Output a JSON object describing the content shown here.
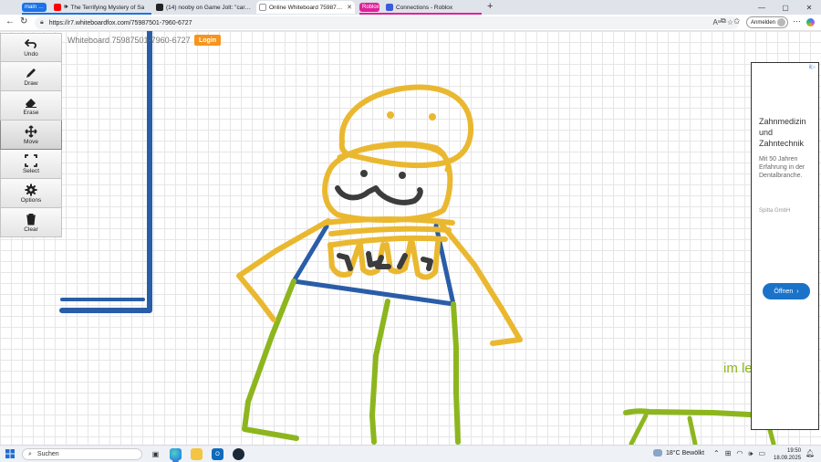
{
  "tabs": [
    {
      "label": "main",
      "group_color": "#1a73e8",
      "icon": "tab-group-chip"
    },
    {
      "label": "The Terrifying Mystery of Sa",
      "icon": "youtube-icon",
      "fav_color": "#ff0000"
    },
    {
      "label": "(14) nooby on Game Jolt: \"carele",
      "icon": "gamejolt-icon",
      "fav_color": "#222222"
    },
    {
      "label": "Online Whiteboard 75987501-79",
      "icon": "whiteboard-icon",
      "fav_color": "#ffffff",
      "active": true
    },
    {
      "label": "Roblox",
      "group_color": "#e0209a",
      "icon": "tab-group-chip"
    },
    {
      "label": "Connections - Roblox",
      "icon": "roblox-icon",
      "fav_color": "#3b5bdb"
    }
  ],
  "address_bar": {
    "url": "https://r7.whiteboardfox.com/75987501-7960-6727",
    "signin_label": "Anmelden"
  },
  "whiteboard": {
    "title": "Whiteboard 75987501-7960-6727",
    "login_label": "Login",
    "canvas_text": "im le",
    "colors": {
      "blue": "#2a5da8",
      "yellow": "#eab830",
      "green": "#8db61e",
      "dark": "#3c3c3c"
    }
  },
  "tools": [
    {
      "label": "Undo",
      "icon": "undo-icon"
    },
    {
      "label": "Draw",
      "icon": "pencil-icon"
    },
    {
      "label": "Erase",
      "icon": "eraser-icon"
    },
    {
      "label": "Move",
      "icon": "move-icon",
      "active": true
    },
    {
      "label": "Select",
      "icon": "select-icon"
    },
    {
      "label": "Options",
      "icon": "gear-icon"
    },
    {
      "label": "Clear",
      "icon": "trash-icon"
    }
  ],
  "ad": {
    "title": "Zahnmedizin und Zahntechnik",
    "body": "Mit 50 Jahren Erfahrung in der Dentalbranche.",
    "brand": "Spitta GmbH",
    "button_label": "Öffnen",
    "choice_label": "ⅱ▷"
  },
  "taskbar": {
    "search_label": "Suchen",
    "weather": "18°C  Bewölkt",
    "time": "19:50",
    "date": "18.09.2025"
  }
}
